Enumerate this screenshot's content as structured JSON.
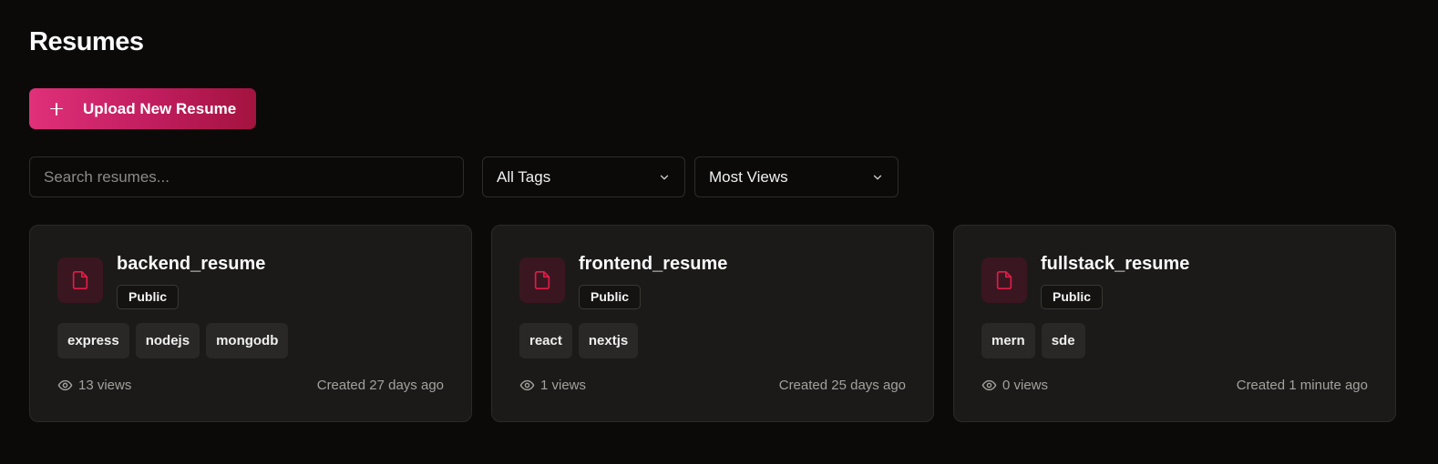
{
  "page": {
    "title": "Resumes"
  },
  "toolbar": {
    "upload_label": "Upload New Resume",
    "search_placeholder": "Search resumes...",
    "tags_select": "All Tags",
    "sort_select": "Most Views"
  },
  "colors": {
    "accent_start": "#e0307a",
    "accent_end": "#a3133f",
    "file_icon": "#e11d48",
    "background": "#0b0a09",
    "card": "#1c1a18"
  },
  "resumes": [
    {
      "name": "backend_resume",
      "visibility": "Public",
      "tags": [
        "express",
        "nodejs",
        "mongodb"
      ],
      "views": "13 views",
      "created": "Created 27 days ago"
    },
    {
      "name": "frontend_resume",
      "visibility": "Public",
      "tags": [
        "react",
        "nextjs"
      ],
      "views": "1 views",
      "created": "Created 25 days ago"
    },
    {
      "name": "fullstack_resume",
      "visibility": "Public",
      "tags": [
        "mern",
        "sde"
      ],
      "views": "0 views",
      "created": "Created 1 minute ago"
    }
  ]
}
